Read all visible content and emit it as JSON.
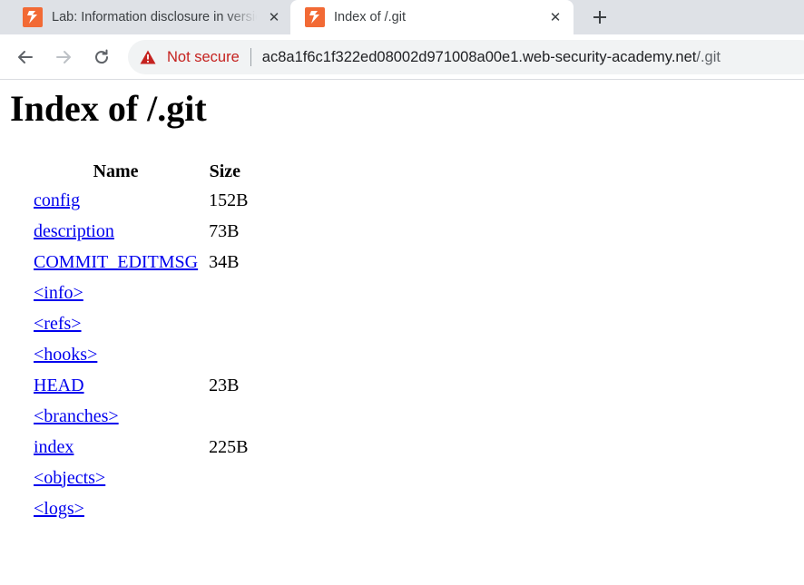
{
  "browser": {
    "tabs": [
      {
        "title": "Lab: Information disclosure in version control history",
        "favicon": "portswigger-logo",
        "active": false
      },
      {
        "title": "Index of /.git",
        "favicon": "portswigger-logo",
        "active": true
      }
    ],
    "new_tab_symbol": "+",
    "close_symbol": "✕",
    "address_bar": {
      "security_label": "Not secure",
      "url_host": "ac8a1f6c1f322ed08002d971008a00e1.web-security-academy.net",
      "url_path": "/.git"
    },
    "colors": {
      "accent": "#f26a35",
      "warning": "#c5221f",
      "link": "#0000ee"
    }
  },
  "page": {
    "heading": "Index of /.git",
    "columns": {
      "name": "Name",
      "size": "Size"
    },
    "entries": [
      {
        "name": "config",
        "size": "152B"
      },
      {
        "name": "description",
        "size": "73B"
      },
      {
        "name": "COMMIT_EDITMSG",
        "size": "34B"
      },
      {
        "name": "<info>",
        "size": ""
      },
      {
        "name": "<refs>",
        "size": ""
      },
      {
        "name": "<hooks>",
        "size": ""
      },
      {
        "name": "HEAD",
        "size": "23B"
      },
      {
        "name": "<branches>",
        "size": ""
      },
      {
        "name": "index",
        "size": "225B"
      },
      {
        "name": "<objects>",
        "size": ""
      },
      {
        "name": "<logs>",
        "size": ""
      }
    ]
  }
}
